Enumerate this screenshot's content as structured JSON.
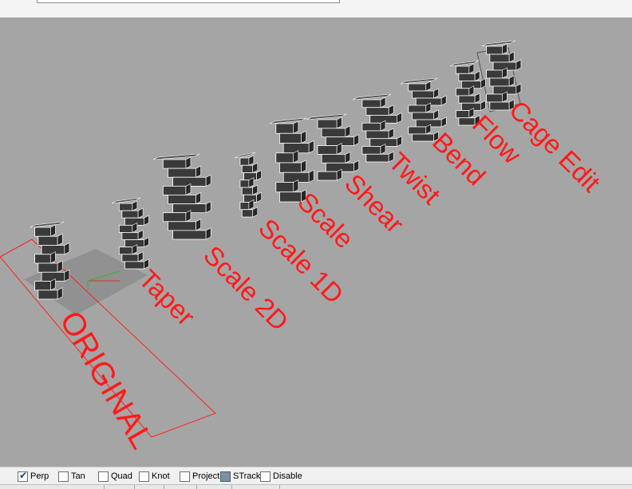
{
  "viewport": {
    "labels": [
      {
        "id": "original",
        "text": "ORIGINAL"
      },
      {
        "id": "taper",
        "text": "Taper"
      },
      {
        "id": "scale2d",
        "text": "Scale 2D"
      },
      {
        "id": "scale1d",
        "text": "Scale 1D"
      },
      {
        "id": "scale",
        "text": "Scale"
      },
      {
        "id": "shear",
        "text": "Shear"
      },
      {
        "id": "twist",
        "text": "Twist"
      },
      {
        "id": "bend",
        "text": "Bend"
      },
      {
        "id": "flow",
        "text": "Flow"
      },
      {
        "id": "cageedit",
        "text": "Cage Edit"
      }
    ],
    "colors": {
      "background": "#a5a5a5",
      "label": "#ff1a1a",
      "object_fill": "#3a3a3a",
      "object_edge": "#ffffff"
    }
  },
  "snapbar": {
    "items": [
      {
        "label": "Perp",
        "checked": true
      },
      {
        "label": "Tan",
        "checked": false
      },
      {
        "label": "Quad",
        "checked": false
      },
      {
        "label": "Knot",
        "checked": false
      },
      {
        "label": "Project",
        "checked": false
      },
      {
        "label": "STrack",
        "checked": true
      },
      {
        "label": "Disable",
        "checked": false
      }
    ]
  }
}
